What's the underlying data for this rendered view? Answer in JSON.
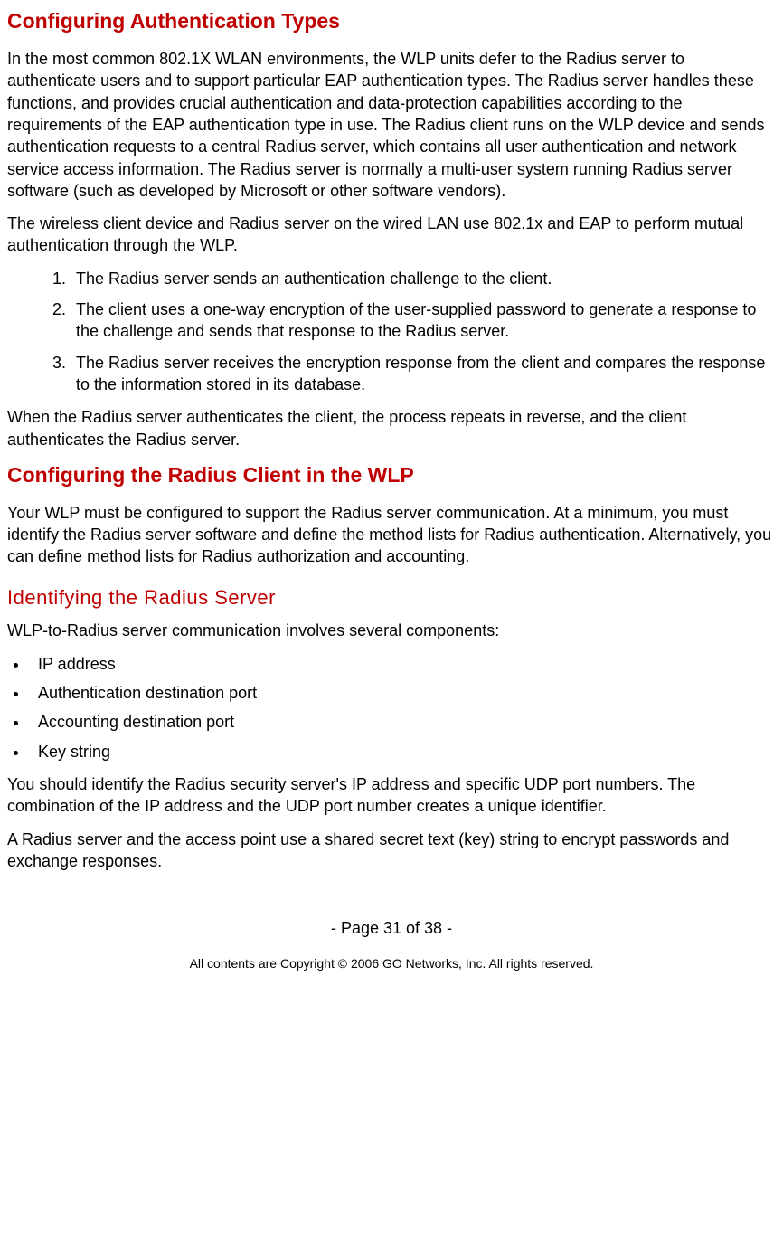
{
  "heading1": "Configuring Authentication Types",
  "para1": "In the most common 802.1X WLAN environments, the WLP units defer to the Radius server to authenticate users and to support particular EAP authentication types. The Radius server handles these functions, and provides crucial authentication and data-protection capabilities according to the requirements of the EAP authentication type in use. The Radius client runs on the WLP device and sends authentication requests to a central Radius server, which contains all user authentication and network service access information. The Radius server is normally a multi-user system running Radius server software (such as developed by Microsoft or other software vendors).",
  "para2": "The wireless client device and Radius server on the wired LAN use 802.1x and EAP to perform mutual authentication through the WLP.",
  "steps": [
    "The Radius server sends an authentication challenge to the client.",
    "The client uses a one-way encryption of the user-supplied password to generate a response to the challenge and sends that response to the Radius server.",
    "The Radius server receives the encryption response from the client and compares the response to the information stored in its database."
  ],
  "para3": "When the Radius server authenticates the client, the process repeats in reverse, and the client authenticates the Radius server.",
  "heading2": "Configuring the Radius Client in the WLP",
  "para4": "Your WLP must be configured to support the Radius server communication. At a minimum, you must identify the Radius server software and define the method lists for Radius authentication. Alternatively, you can define method lists for Radius authorization and accounting.",
  "heading3": "Identifying the Radius Server",
  "para5": "WLP-to-Radius server communication involves several components:",
  "bullets": [
    "IP address",
    "Authentication destination port",
    "Accounting destination port",
    "Key string"
  ],
  "para6": "You should identify the Radius security server's IP address and specific UDP port numbers. The combination of the IP address and the UDP port number creates a unique identifier.",
  "para7": "A Radius server and the access point use a shared secret text (key) string to encrypt passwords and exchange responses.",
  "footer": {
    "page": "- Page 31 of 38 -",
    "copyright": "All contents are Copyright © 2006 GO Networks, Inc. All rights reserved."
  }
}
